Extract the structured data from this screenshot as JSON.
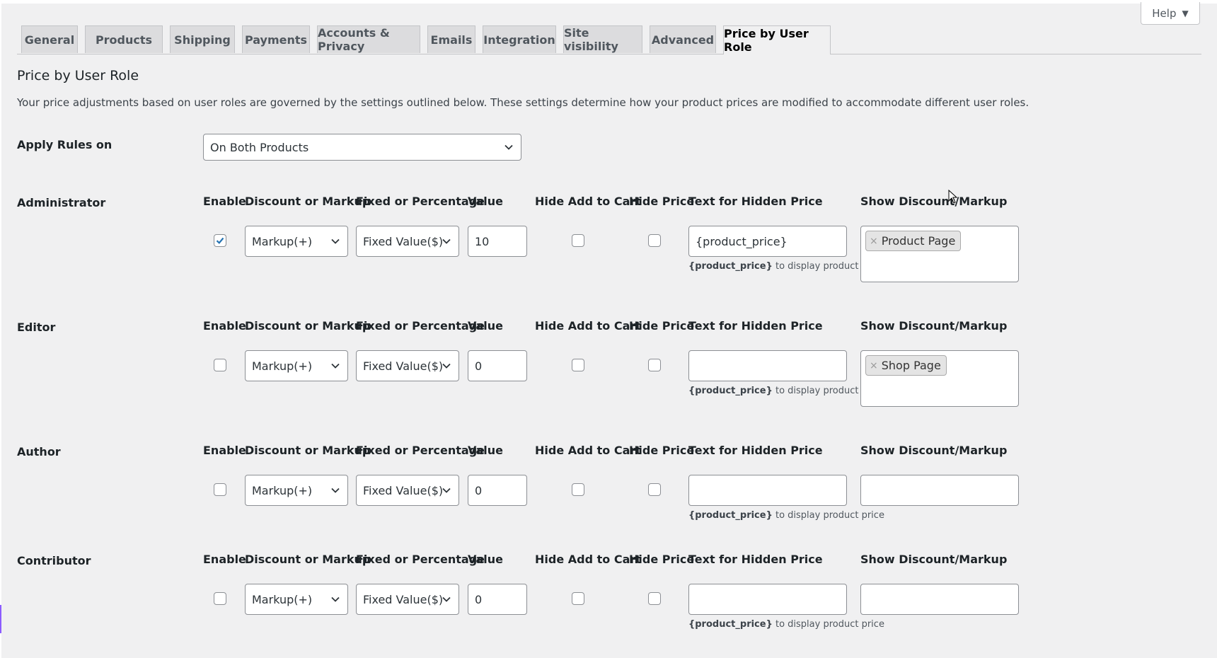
{
  "help_button": {
    "label": "Help",
    "caret": "▼"
  },
  "tabs": [
    {
      "label": "General"
    },
    {
      "label": "Products"
    },
    {
      "label": "Shipping"
    },
    {
      "label": "Payments"
    },
    {
      "label": "Accounts & Privacy"
    },
    {
      "label": "Emails"
    },
    {
      "label": "Integration"
    },
    {
      "label": "Site visibility"
    },
    {
      "label": "Advanced"
    },
    {
      "label": "Price by User Role",
      "active": true
    }
  ],
  "page": {
    "title": "Price by User Role",
    "description": "Your price adjustments based on user roles are governed by the settings outlined below. These settings determine how your product prices are modified to accommodate different user roles."
  },
  "apply_rules": {
    "label": "Apply Rules on",
    "value": "On Both Products"
  },
  "columns": {
    "enable": "Enable",
    "discount": "Discount or Markup",
    "fixed": "Fixed or Percentage",
    "value": "Value",
    "hide_cart": "Hide Add to Cart",
    "hide_price": "Hide Price",
    "hidden_text": "Text for Hidden Price",
    "show_discount": "Show Discount/Markup"
  },
  "hint": {
    "token": "{product_price}",
    "rest": " to display product price"
  },
  "roles": [
    {
      "name": "Administrator",
      "enabled": true,
      "discount": "Markup(+)",
      "fixed": "Fixed Value($)",
      "value": "10",
      "hide_cart": false,
      "hide_price": false,
      "hidden_text": "{product_price}",
      "tags": [
        "Product Page"
      ]
    },
    {
      "name": "Editor",
      "enabled": false,
      "discount": "Markup(+)",
      "fixed": "Fixed Value($)",
      "value": "0",
      "hide_cart": false,
      "hide_price": false,
      "hidden_text": "",
      "tags": [
        "Shop Page"
      ]
    },
    {
      "name": "Author",
      "enabled": false,
      "discount": "Markup(+)",
      "fixed": "Fixed Value($)",
      "value": "0",
      "hide_cart": false,
      "hide_price": false,
      "hidden_text": "",
      "tags": []
    },
    {
      "name": "Contributor",
      "enabled": false,
      "discount": "Markup(+)",
      "fixed": "Fixed Value($)",
      "value": "0",
      "hide_cart": false,
      "hide_price": false,
      "hidden_text": "",
      "tags": []
    }
  ],
  "colors": {
    "accent": "#2271b1",
    "text": "#1d2327",
    "background": "#f0f0f1"
  },
  "icons": {
    "chevron": "chevron-down-icon",
    "check": "checkmark-icon",
    "remove": "remove-tag-icon",
    "cursor": "mouse-cursor-icon"
  }
}
